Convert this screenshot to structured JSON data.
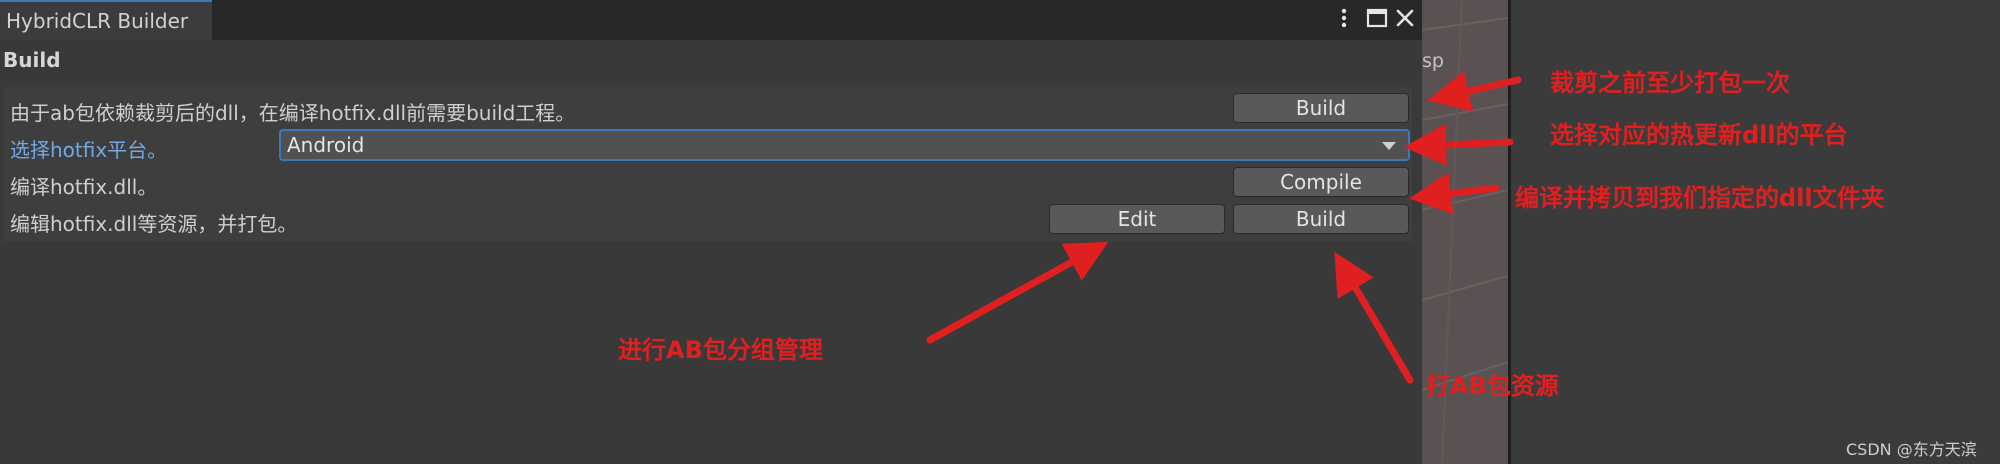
{
  "window": {
    "tab_title": "HybridCLR Builder",
    "icons": [
      "more-vertical-icon",
      "maximize-icon",
      "close-icon"
    ]
  },
  "section": {
    "title": "Build"
  },
  "rows": [
    {
      "label": "由于ab包依赖裁剪后的dll，在编译hotfix.dll前需要build工程。",
      "buttons": [
        "Build"
      ]
    },
    {
      "label": "选择hotfix平台。",
      "dropdown_value": "Android"
    },
    {
      "label": "编译hotfix.dll。",
      "buttons": [
        "Compile"
      ]
    },
    {
      "label": "编辑hotfix.dll等资源，并打包。",
      "buttons": [
        "Edit",
        "Build"
      ]
    }
  ],
  "side_strip": {
    "text": "sp"
  },
  "annotations": [
    "裁剪之前至少打包一次",
    "选择对应的热更新dll的平台",
    "编译并拷贝到我们指定的dll文件夹",
    "进行AB包分组管理",
    "打AB包资源"
  ],
  "watermark": "CSDN @东方天滨",
  "colors": {
    "panel_bg": "#393939",
    "tab_accent": "#3a79bb",
    "link_text": "#74a8e4",
    "annotation_red": "#e02020"
  }
}
